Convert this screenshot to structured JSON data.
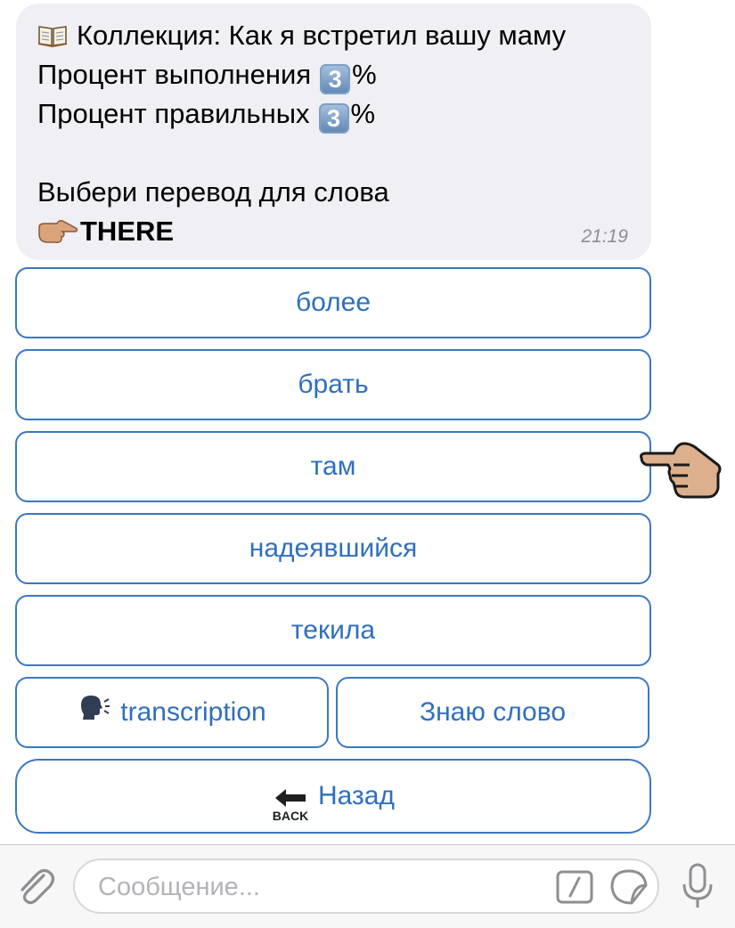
{
  "message": {
    "title": "Коллекция: Как я встретил вашу маму",
    "completion_label": "Процент выполнения",
    "completion_value": "3",
    "correct_label": "Процент правильных",
    "correct_value": "3",
    "percent_sign": "%",
    "prompt": "Выбери перевод для слова",
    "word": "THERE",
    "time": "21:19"
  },
  "keyboard": {
    "options": [
      "более",
      "брать",
      "там",
      "надеявшийся",
      "текила"
    ],
    "transcription": "transcription",
    "know_word": "Знаю слово",
    "back": "Назад",
    "back_icon_text": "BACK"
  },
  "input": {
    "placeholder": "Сообщение..."
  },
  "icons": {
    "book": "open-book-icon",
    "keycap": "keycap-digit-icon",
    "pointer": "pointing-right-hand-icon",
    "speaking_head": "speaking-head-icon",
    "back_arrow": "back-arrow-icon",
    "attach": "paperclip-icon",
    "command": "slash-command-icon",
    "sticker": "sticker-icon",
    "microphone": "microphone-icon"
  },
  "colors": {
    "accent": "#2f6fbf",
    "button_border": "#3a78c3",
    "bubble_bg": "#efeff4"
  }
}
